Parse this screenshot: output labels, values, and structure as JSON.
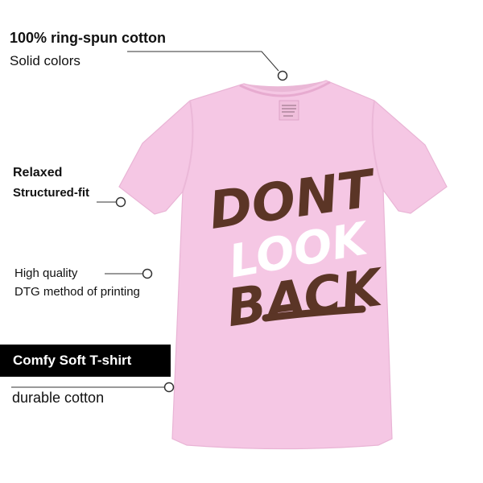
{
  "features": {
    "material": {
      "title": "100% ring-spun cotton",
      "subtitle": "Solid colors"
    },
    "fit": {
      "title": "Relaxed",
      "subtitle": "Structured-fit"
    },
    "print": {
      "title": "High quality",
      "subtitle": "DTG method of printing"
    },
    "comfort": {
      "badge": "Comfy Soft T-shirt",
      "subtitle": "durable cotton"
    }
  },
  "design": {
    "line1": "DONT",
    "line2": "LOOK",
    "line3": "BACK"
  },
  "colors": {
    "shirt": "#f5c7e4",
    "ink_brown": "#5b3526",
    "ink_white": "#ffffff",
    "badge_bg": "#000000"
  }
}
